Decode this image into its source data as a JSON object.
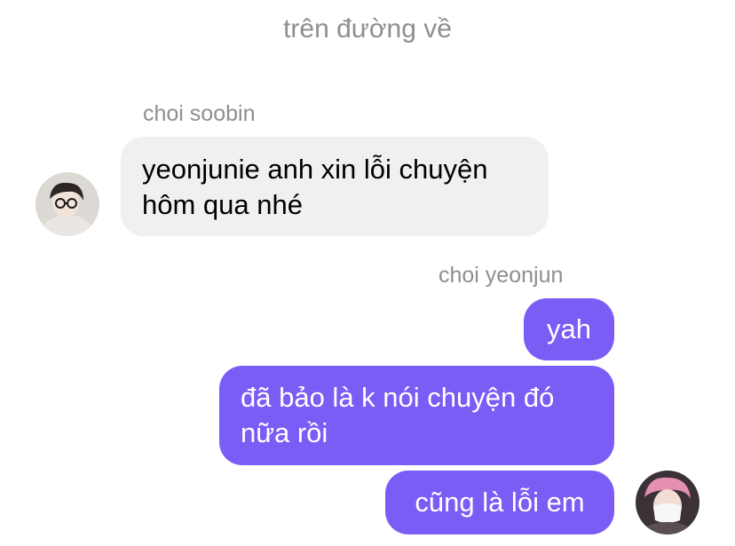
{
  "conversation": {
    "title": "trên đường về"
  },
  "messages": {
    "soobin_name": "choi soobin",
    "soobin_msg_1_line_1": "yeonjunie anh xin lỗi chuyện",
    "soobin_msg_1_line_2": "hôm qua nhé",
    "yeonjun_name": "choi yeonjun",
    "yeonjun_msg_1": "yah",
    "yeonjun_msg_2_line_1": "đã bảo là k nói chuyện đó",
    "yeonjun_msg_2_line_2": "nữa rồi",
    "yeonjun_msg_3": "cũng là lỗi em"
  },
  "colors": {
    "outgoing_bubble": "#7b5cf5",
    "incoming_bubble": "#f0f0f0",
    "meta_text": "#8e8e93"
  }
}
